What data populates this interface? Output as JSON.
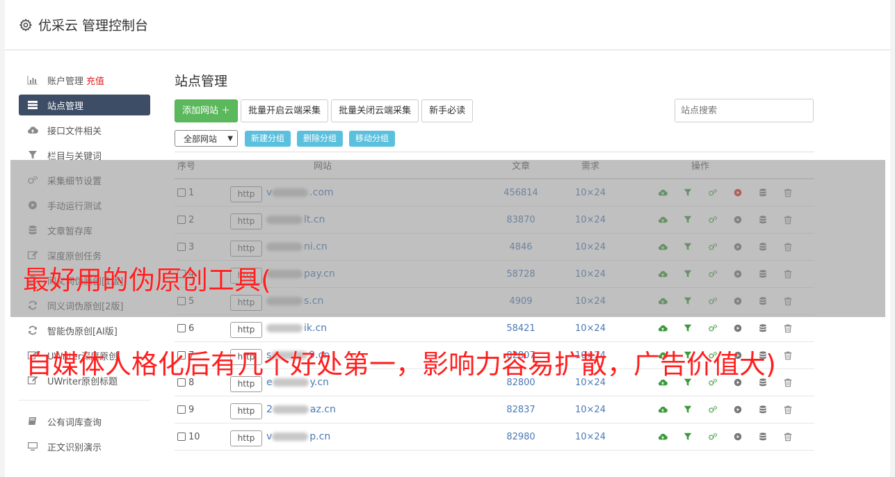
{
  "header": {
    "title": "优采云 管理控制台",
    "icon": "gear-icon"
  },
  "sidebar": {
    "items": [
      {
        "label": "账户管理",
        "extra": "充值",
        "icon": "bar-chart-icon"
      },
      {
        "label": "站点管理",
        "icon": "server-icon",
        "active": true
      },
      {
        "label": "接口文件相关",
        "icon": "cloud-upload-icon"
      },
      {
        "label": "栏目与关键词",
        "icon": "filter-icon"
      },
      {
        "label": "采集细节设置",
        "icon": "gears-icon"
      },
      {
        "label": "手动运行测试",
        "icon": "play-circle-icon"
      },
      {
        "label": "文章暂存库",
        "icon": "database-icon"
      },
      {
        "label": "深度原创任务",
        "icon": "edit-icon"
      },
      {
        "label": "同义词伪原创[1版]",
        "icon": "refresh-icon"
      },
      {
        "label": "同义词伪原创[2版]",
        "icon": "refresh-icon"
      },
      {
        "label": "智能伪原创[AI版]",
        "icon": "refresh-icon"
      },
      {
        "label": "UWriter深度原创",
        "icon": "edit-icon"
      },
      {
        "label": "UWriter原创标题",
        "icon": "edit-icon"
      }
    ],
    "items2": [
      {
        "label": "公有词库查询",
        "icon": "book-icon"
      },
      {
        "label": "正文识别演示",
        "icon": "monitor-icon"
      }
    ]
  },
  "main": {
    "title": "站点管理",
    "buttons": {
      "add": "添加网站 ＋",
      "enable_cloud": "批量开启云端采集",
      "disable_cloud": "批量关闭云端采集",
      "guide": "新手必读"
    },
    "search_placeholder": "站点搜索",
    "group_select": "全部网站",
    "group_buttons": {
      "new": "新建分组",
      "delete": "删除分组",
      "move": "移动分组"
    },
    "columns": {
      "no": "序号",
      "site": "网站",
      "articles": "文章",
      "demand": "需求",
      "ops": "操作"
    },
    "rows": [
      {
        "no": "1",
        "proto": "http",
        "domain_prefix": "v",
        "domain_suffix": ".com",
        "articles": "456814",
        "demand": "10×24",
        "running": true
      },
      {
        "no": "2",
        "proto": "http",
        "domain_prefix": "",
        "domain_suffix": "lt.cn",
        "articles": "83870",
        "demand": "10×24"
      },
      {
        "no": "3",
        "proto": "http",
        "domain_prefix": "",
        "domain_suffix": "ni.cn",
        "articles": "4846",
        "demand": "10×24"
      },
      {
        "no": "4",
        "proto": "http",
        "domain_prefix": "",
        "domain_suffix": "pay.cn",
        "articles": "58728",
        "demand": "10×24"
      },
      {
        "no": "5",
        "proto": "http",
        "domain_prefix": "",
        "domain_suffix": "s.cn",
        "articles": "4909",
        "demand": "10×24"
      },
      {
        "no": "6",
        "proto": "http",
        "domain_prefix": "",
        "domain_suffix": "ik.cn",
        "articles": "58421",
        "demand": "10×24"
      },
      {
        "no": "7",
        "proto": "http",
        "domain_prefix": "s",
        "domain_suffix": "9.cn",
        "articles": "82807",
        "demand": "10×24"
      },
      {
        "no": "8",
        "proto": "http",
        "domain_prefix": "e",
        "domain_suffix": "y.cn",
        "articles": "82800",
        "demand": "10×24"
      },
      {
        "no": "9",
        "proto": "http",
        "domain_prefix": "2",
        "domain_suffix": "az.cn",
        "articles": "82837",
        "demand": "10×24"
      },
      {
        "no": "10",
        "proto": "http",
        "domain_prefix": "v",
        "domain_suffix": "p.cn",
        "articles": "82980",
        "demand": "10×24"
      }
    ]
  },
  "overlay": {
    "line1": "最好用的伪原创工具(",
    "line2": "自媒体人格化后有几个好处第一，影响力容易扩散，广告价值大)"
  },
  "colors": {
    "sidebar_active": "#3e4d66",
    "green": "#5cb85c",
    "info": "#5bc0de",
    "link": "#4a78b5",
    "overlay_text": "#ff1e1e"
  }
}
